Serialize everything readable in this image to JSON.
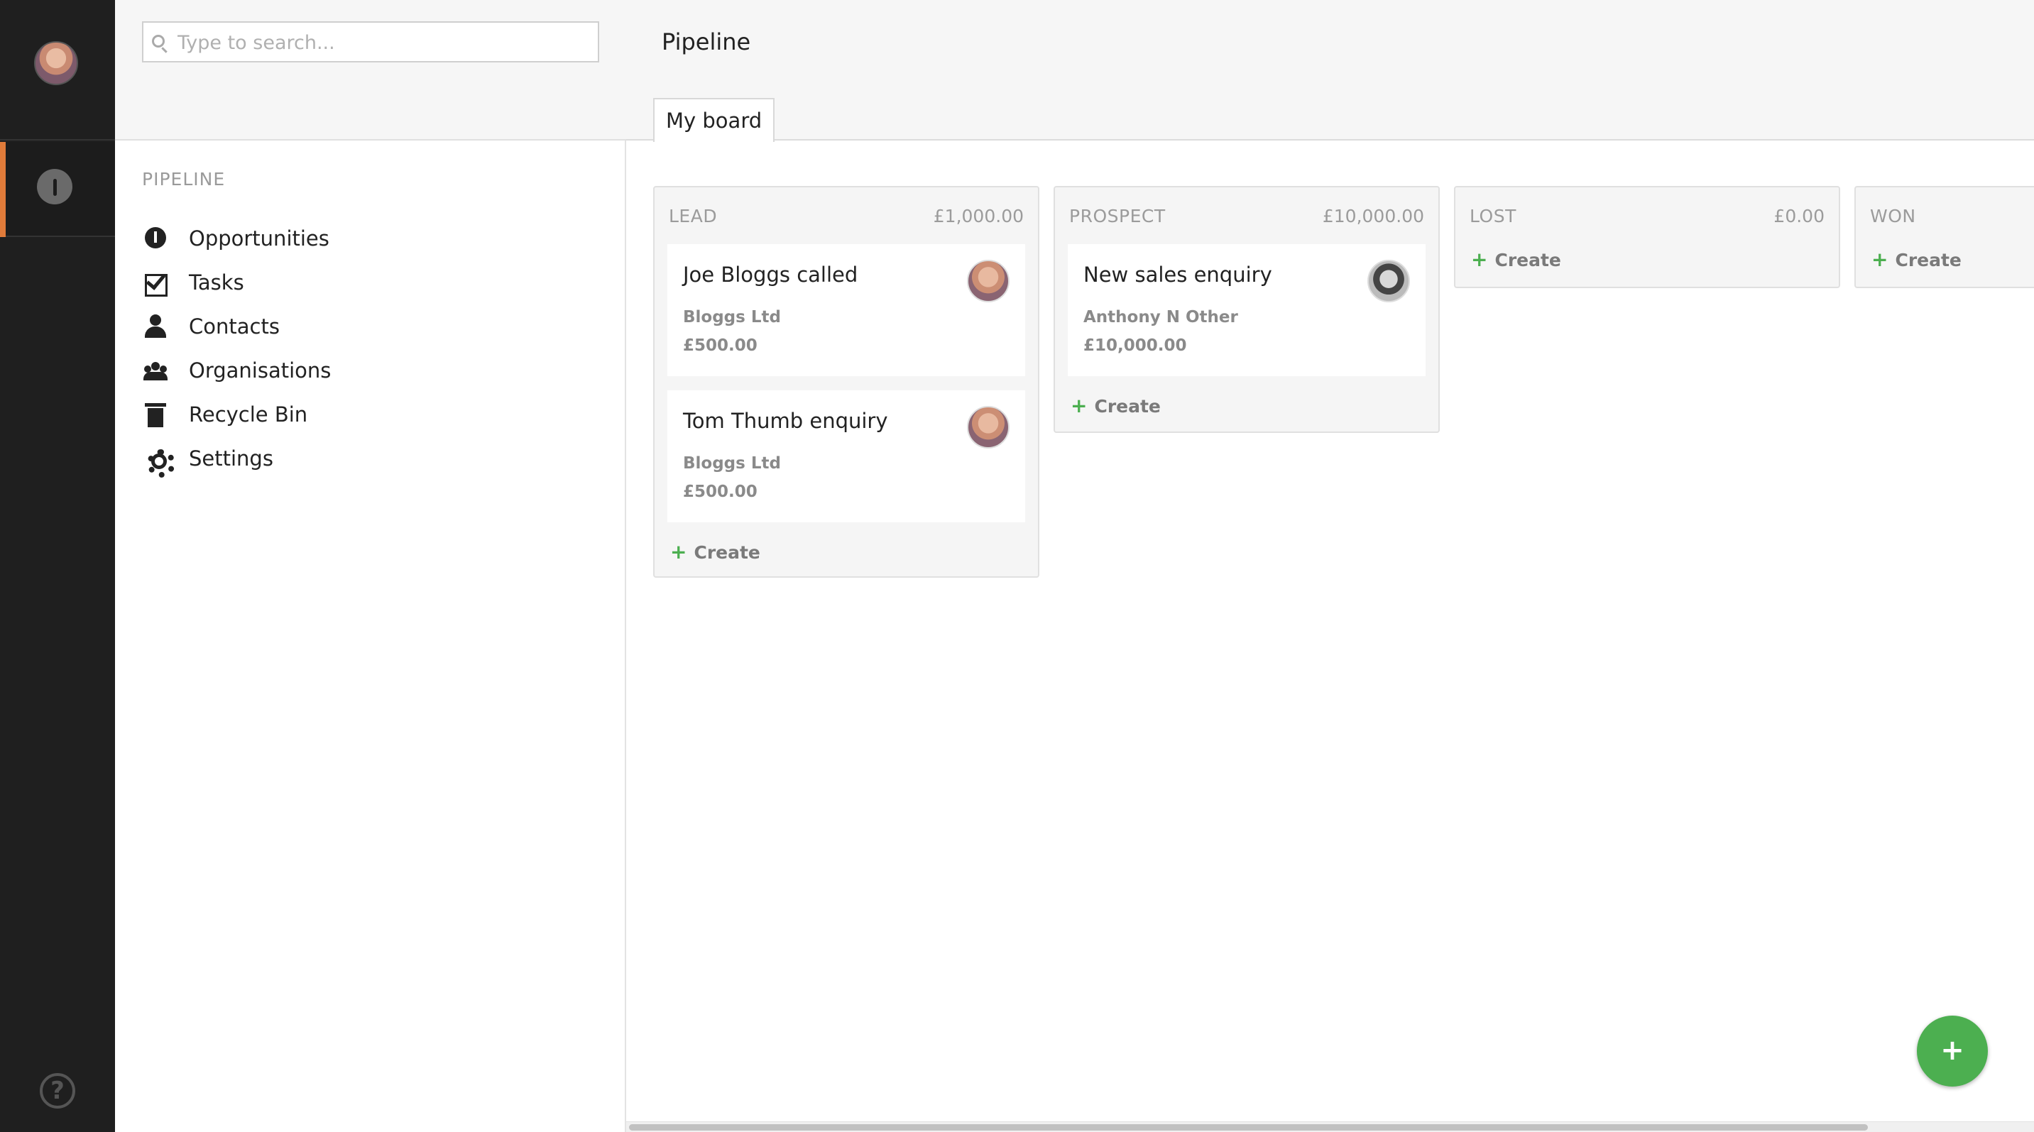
{
  "search": {
    "placeholder": "Type to search..."
  },
  "nav": {
    "heading": "PIPELINE",
    "items": [
      {
        "label": "Opportunities",
        "icon": "opportunities-icon"
      },
      {
        "label": "Tasks",
        "icon": "tasks-icon"
      },
      {
        "label": "Contacts",
        "icon": "contacts-icon"
      },
      {
        "label": "Organisations",
        "icon": "organisations-icon"
      },
      {
        "label": "Recycle Bin",
        "icon": "recycle-bin-icon"
      },
      {
        "label": "Settings",
        "icon": "settings-icon"
      }
    ]
  },
  "main": {
    "title": "Pipeline",
    "tab": "My board"
  },
  "columns": [
    {
      "name": "LEAD",
      "total": "£1,000.00",
      "cards": [
        {
          "title": "Joe Bloggs called",
          "org": "Bloggs Ltd",
          "amount": "£500.00"
        },
        {
          "title": "Tom Thumb enquiry",
          "org": "Bloggs Ltd",
          "amount": "£500.00"
        }
      ],
      "create": "Create"
    },
    {
      "name": "PROSPECT",
      "total": "£10,000.00",
      "cards": [
        {
          "title": "New sales enquiry",
          "org": "Anthony N Other",
          "amount": "£10,000.00"
        }
      ],
      "create": "Create"
    },
    {
      "name": "LOST",
      "total": "£0.00",
      "cards": [],
      "create": "Create"
    },
    {
      "name": "WON",
      "total": "",
      "cards": [],
      "create": "Create"
    }
  ],
  "fab": {
    "label": "+"
  },
  "help": {
    "label": "?"
  },
  "colors": {
    "accent": "#e07b3a",
    "create_green": "#4caf50",
    "rail": "#1f1f1f"
  }
}
